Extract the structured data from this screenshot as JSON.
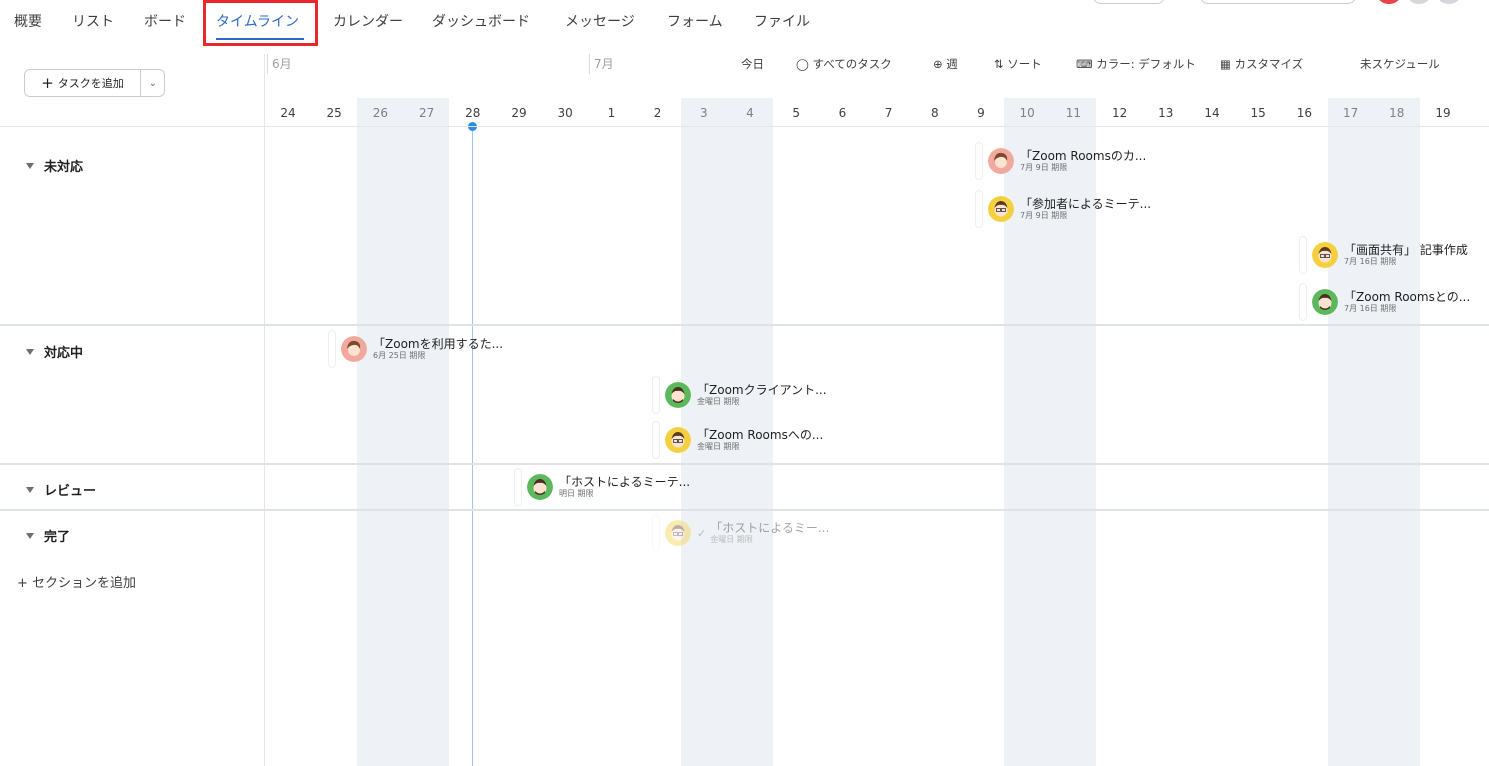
{
  "nav": {
    "tabs": [
      {
        "label": "概要"
      },
      {
        "label": "リスト"
      },
      {
        "label": "ボード"
      },
      {
        "label": "タイムライン"
      },
      {
        "label": "カレンダー"
      },
      {
        "label": "ダッシュボード"
      },
      {
        "label": "メッセージ"
      },
      {
        "label": "フォーム"
      },
      {
        "label": "ファイル"
      }
    ],
    "active_tab": "タイムライン"
  },
  "left": {
    "add_task_label": "タスクを追加",
    "sections": [
      {
        "label": "未対応"
      },
      {
        "label": "対応中"
      },
      {
        "label": "レビュー"
      },
      {
        "label": "完了"
      }
    ],
    "add_section_label": "+ セクションを追加"
  },
  "timeline": {
    "months": [
      "6月",
      "7月"
    ],
    "toolbar": {
      "today": "今日",
      "all_tasks": "すべてのタスク",
      "week": "週",
      "sort": "ソート",
      "color": "カラー: デフォルト",
      "customize": "カスタマイズ",
      "unscheduled": "未スケジュール"
    },
    "days": [
      "24",
      "25",
      "26",
      "27",
      "28",
      "29",
      "30",
      "1",
      "2",
      "3",
      "4",
      "5",
      "6",
      "7",
      "8",
      "9",
      "10",
      "11",
      "12",
      "13",
      "14",
      "15",
      "16",
      "17",
      "18",
      "19"
    ],
    "today_label": "28"
  },
  "tasks": [
    {
      "title": "「Zoom Roomsのカ...",
      "due": "7月 9日 期限",
      "section": "未対応",
      "avatar": "woman-avatar"
    },
    {
      "title": "「参加者によるミーテ...",
      "due": "7月 9日 期限",
      "section": "未対応",
      "avatar": "man-yellow-avatar"
    },
    {
      "title": "「画面共有」 記事作成",
      "due": "7月 16日 期限",
      "section": "未対応",
      "avatar": "man-yellow-avatar"
    },
    {
      "title": "「Zoom Roomsとの...",
      "due": "7月 16日 期限",
      "section": "未対応",
      "avatar": "man-green-avatar"
    },
    {
      "title": "「Zoomを利用するた...",
      "due": "6月 25日 期限",
      "section": "対応中",
      "avatar": "woman-avatar"
    },
    {
      "title": "「Zoomクライアント...",
      "due": "金曜日 期限",
      "section": "対応中",
      "avatar": "man-green-avatar"
    },
    {
      "title": "「Zoom Roomsへの...",
      "due": "金曜日 期限",
      "section": "対応中",
      "avatar": "man-yellow-avatar"
    },
    {
      "title": "「ホストによるミーテ...",
      "due": "明日 期限",
      "section": "レビュー",
      "avatar": "man-green-avatar"
    },
    {
      "title": "「ホストによるミー...",
      "due": "金曜日 期限",
      "section": "完了",
      "avatar": "man-yellow-avatar",
      "completed": true
    }
  ],
  "colors": {
    "accent": "#2c69c4",
    "highlight": "#e8262b",
    "weekend": "#eef1f5",
    "today_line": "#9fc6ec"
  }
}
